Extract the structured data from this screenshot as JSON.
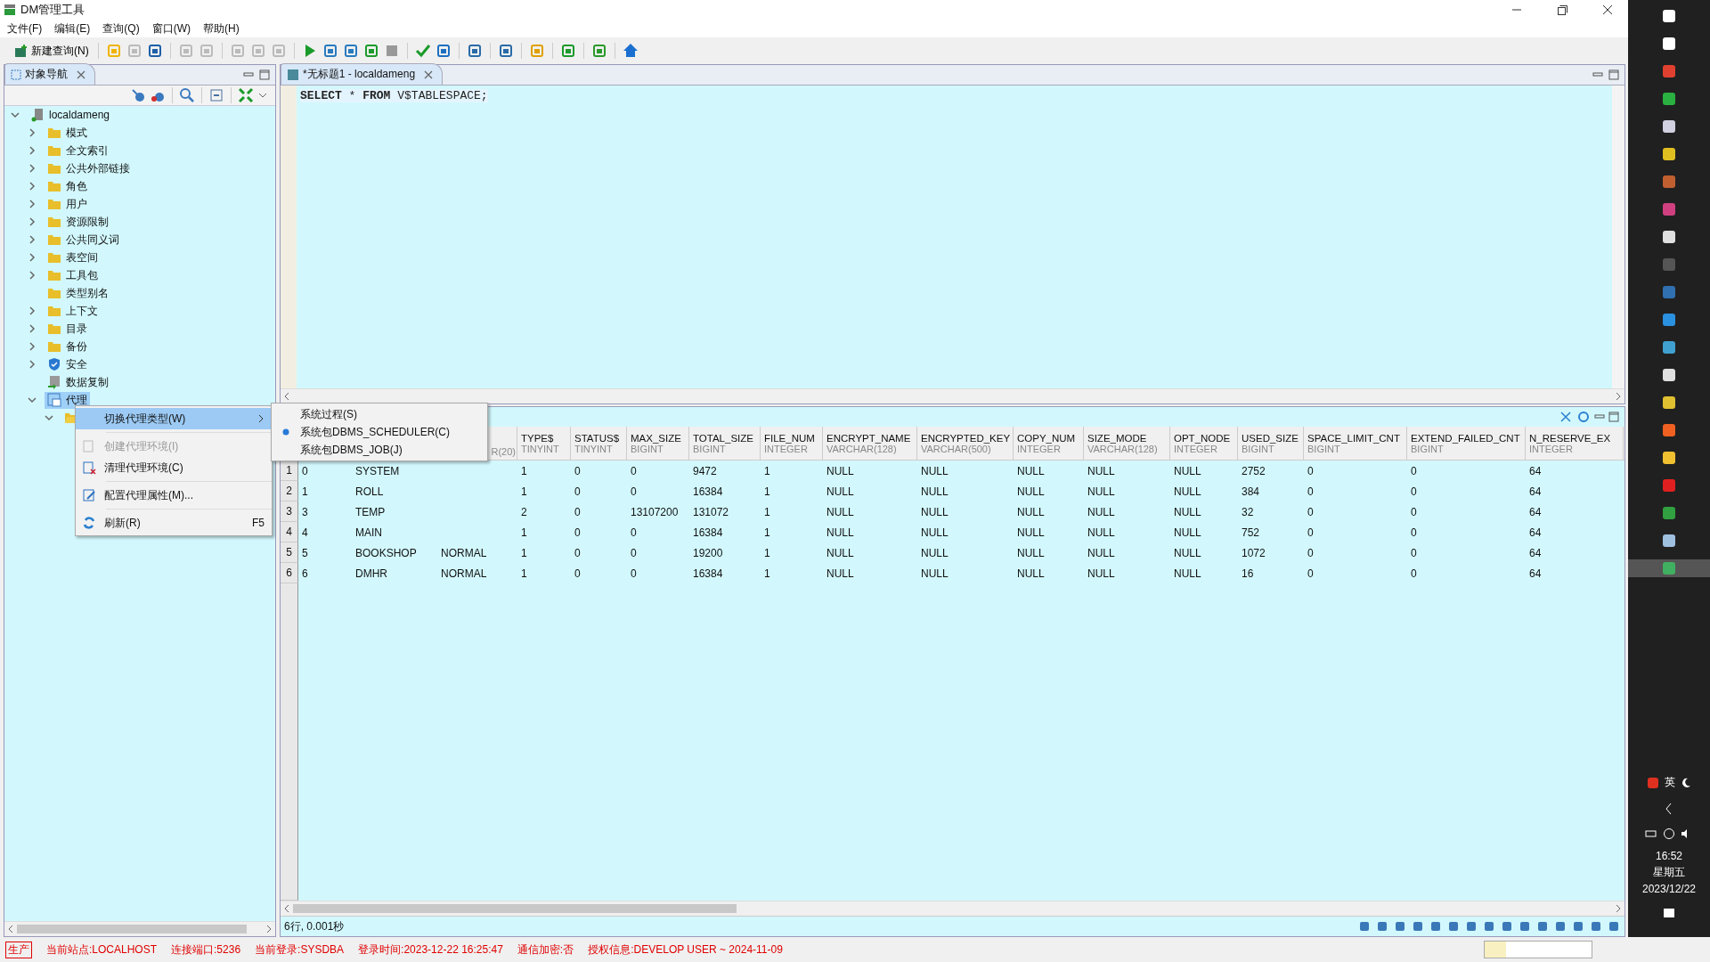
{
  "window": {
    "title": "DM管理工具"
  },
  "menu": [
    "文件(F)",
    "编辑(E)",
    "查询(Q)",
    "窗口(W)",
    "帮助(H)"
  ],
  "toolbar": {
    "new_query": "新建查询(N)"
  },
  "navigator": {
    "tab": "对象导航",
    "tree": [
      {
        "label": "localdameng",
        "kind": "server",
        "expanded": true,
        "selected": false,
        "has_children": true,
        "children": [
          {
            "label": "模式",
            "kind": "folder",
            "expanded": false,
            "selected": false,
            "has_children": true
          },
          {
            "label": "全文索引",
            "kind": "folder",
            "expanded": false,
            "selected": false,
            "has_children": true
          },
          {
            "label": "公共外部链接",
            "kind": "folder",
            "expanded": false,
            "selected": false,
            "has_children": true
          },
          {
            "label": "角色",
            "kind": "folder",
            "expanded": false,
            "selected": false,
            "has_children": true
          },
          {
            "label": "用户",
            "kind": "folder",
            "expanded": false,
            "selected": false,
            "has_children": true
          },
          {
            "label": "资源限制",
            "kind": "folder",
            "expanded": false,
            "selected": false,
            "has_children": true
          },
          {
            "label": "公共同义词",
            "kind": "folder",
            "expanded": false,
            "selected": false,
            "has_children": true
          },
          {
            "label": "表空间",
            "kind": "folder",
            "expanded": false,
            "selected": false,
            "has_children": true
          },
          {
            "label": "工具包",
            "kind": "folder",
            "expanded": false,
            "selected": false,
            "has_children": true
          },
          {
            "label": "类型别名",
            "kind": "folder",
            "expanded": false,
            "selected": false,
            "has_children": false
          },
          {
            "label": "上下文",
            "kind": "folder",
            "expanded": false,
            "selected": false,
            "has_children": true
          },
          {
            "label": "目录",
            "kind": "folder",
            "expanded": false,
            "selected": false,
            "has_children": true
          },
          {
            "label": "备份",
            "kind": "folder",
            "expanded": false,
            "selected": false,
            "has_children": true
          },
          {
            "label": "安全",
            "kind": "shield",
            "expanded": false,
            "selected": false,
            "has_children": true
          },
          {
            "label": "数据复制",
            "kind": "replication",
            "expanded": false,
            "selected": false,
            "has_children": false
          },
          {
            "label": "代理",
            "kind": "agent",
            "expanded": true,
            "selected": true,
            "has_children": true,
            "children": [
              {
                "kind": "folder",
                "expanded": true,
                "selected": false,
                "has_children": true
              }
            ]
          }
        ]
      }
    ]
  },
  "context_menu": [
    {
      "kind": "item",
      "label": "切换代理类型(W)",
      "disabled": false,
      "selected": true,
      "submenu": true
    },
    {
      "kind": "separator"
    },
    {
      "kind": "item",
      "label": "创建代理环境(I)",
      "disabled": true,
      "selected": false,
      "submenu": false
    },
    {
      "kind": "item",
      "label": "清理代理环境(C)",
      "disabled": false,
      "selected": false,
      "submenu": false
    },
    {
      "kind": "separator"
    },
    {
      "kind": "item",
      "label": "配置代理属性(M)...",
      "disabled": false,
      "selected": false,
      "submenu": false
    },
    {
      "kind": "separator"
    },
    {
      "kind": "item",
      "label": "刷新(R)",
      "disabled": false,
      "selected": false,
      "submenu": false,
      "shortcut": "F5"
    }
  ],
  "submenu": [
    {
      "label": "系统过程(S)",
      "selected": false
    },
    {
      "label": "系统包DBMS_SCHEDULER(C)",
      "selected": true
    },
    {
      "label": "系统包DBMS_JOB(J)",
      "selected": false
    }
  ],
  "editor": {
    "tab": "*无标题1 - localdameng",
    "sql": "**SELECT** * **FROM** V$TABLESPACE;"
  },
  "results": {
    "columns": [
      null,
      null,
      {
        "type": "R(20)"
      },
      {
        "name": "TYPE$",
        "type": "TINYINT"
      },
      {
        "name": "STATUS$",
        "type": "TINYINT"
      },
      {
        "name": "MAX_SIZE",
        "type": "BIGINT"
      },
      {
        "name": "TOTAL_SIZE",
        "type": "BIGINT"
      },
      {
        "name": "FILE_NUM",
        "type": "INTEGER"
      },
      {
        "name": "ENCRYPT_NAME",
        "type": "VARCHAR(128)"
      },
      {
        "name": "ENCRYPTED_KEY",
        "type": "VARCHAR(500)"
      },
      {
        "name": "COPY_NUM",
        "type": "INTEGER"
      },
      {
        "name": "SIZE_MODE",
        "type": "VARCHAR(128)"
      },
      {
        "name": "OPT_NODE",
        "type": "INTEGER"
      },
      {
        "name": "USED_SIZE",
        "type": "BIGINT"
      },
      {
        "name": "SPACE_LIMIT_CNT",
        "type": "BIGINT"
      },
      {
        "name": "EXTEND_FAILED_CNT",
        "type": "BIGINT"
      },
      {
        "name": "N_RESERVE_EX",
        "type": "INTEGER"
      }
    ],
    "rows": [
      {
        "num": "1",
        "cells": [
          "0",
          "SYSTEM",
          null,
          "1",
          "0",
          "0",
          "9472",
          "1",
          "NULL",
          "NULL",
          "NULL",
          "NULL",
          "NULL",
          "2752",
          "0",
          "0",
          "64"
        ]
      },
      {
        "num": "2",
        "cells": [
          "1",
          "ROLL",
          null,
          "1",
          "0",
          "0",
          "16384",
          "1",
          "NULL",
          "NULL",
          "NULL",
          "NULL",
          "NULL",
          "384",
          "0",
          "0",
          "64"
        ]
      },
      {
        "num": "3",
        "cells": [
          "3",
          "TEMP",
          null,
          "2",
          "0",
          "13107200",
          "131072",
          "1",
          "NULL",
          "NULL",
          "NULL",
          "NULL",
          "NULL",
          "32",
          "0",
          "0",
          "64"
        ]
      },
      {
        "num": "4",
        "cells": [
          "4",
          "MAIN",
          null,
          "1",
          "0",
          "0",
          "16384",
          "1",
          "NULL",
          "NULL",
          "NULL",
          "NULL",
          "NULL",
          "752",
          "0",
          "0",
          "64"
        ]
      },
      {
        "num": "5",
        "cells": [
          "5",
          "BOOKSHOP",
          "NORMAL",
          "1",
          "0",
          "0",
          "19200",
          "1",
          "NULL",
          "NULL",
          "NULL",
          "NULL",
          "NULL",
          "1072",
          "0",
          "0",
          "64"
        ]
      },
      {
        "num": "6",
        "cells": [
          "6",
          "DMHR",
          "NORMAL",
          "1",
          "0",
          "0",
          "16384",
          "1",
          "NULL",
          "NULL",
          "NULL",
          "NULL",
          "NULL",
          "16",
          "0",
          "0",
          "64"
        ]
      }
    ],
    "summary": "6行, 0.001秒"
  },
  "status_bar": {
    "env": "生产",
    "items": [
      "当前站点:LOCALHOST",
      "连接端口:5236",
      "当前登录:SYSDBA",
      "登录时间:2023-12-22 16:25:47",
      "通信加密:否",
      "授权信息:DEVELOP USER ~ 2024-11-09"
    ]
  },
  "taskbar": {
    "ime": "英",
    "time": "16:52",
    "weekday": "星期五",
    "date": "2023/12/22"
  }
}
